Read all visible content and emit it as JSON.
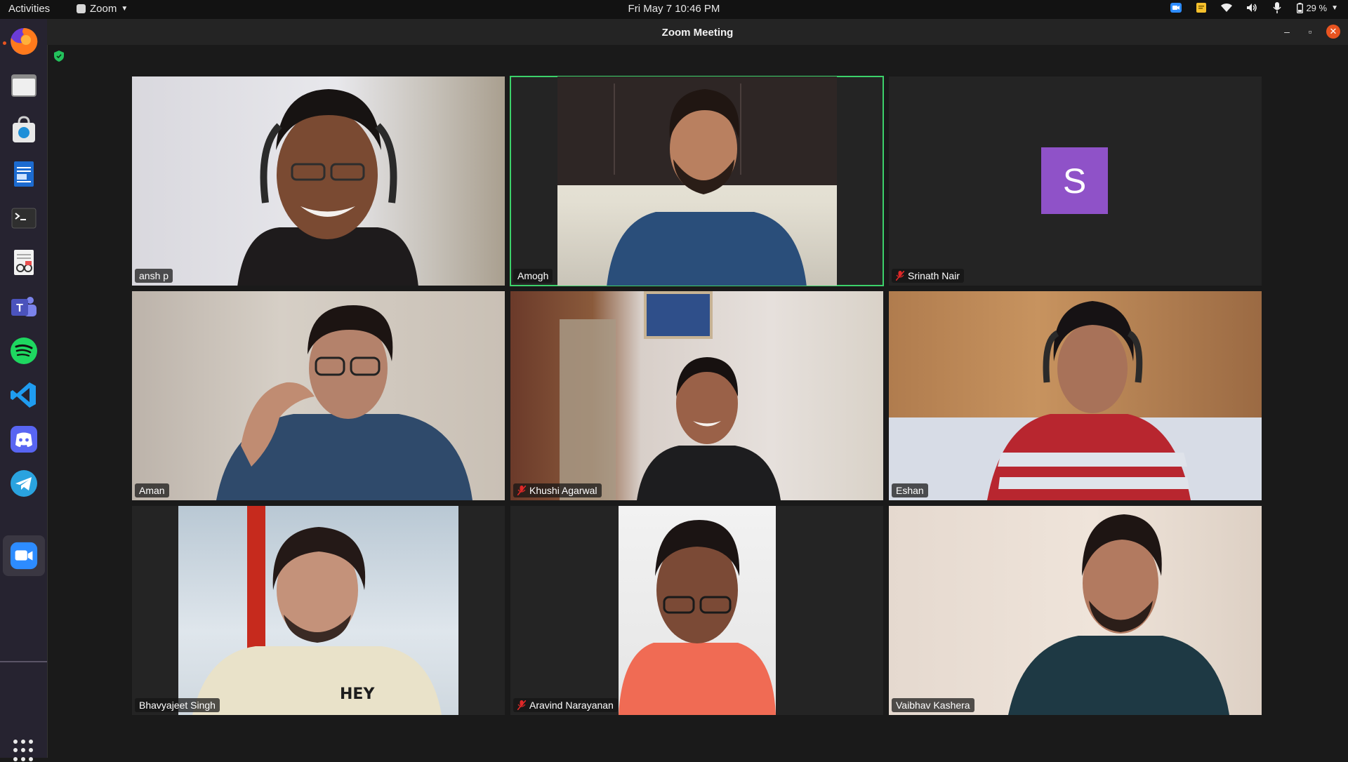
{
  "topbar": {
    "activities": "Activities",
    "app_name": "Zoom",
    "clock": "Fri May 7  10:46 PM",
    "battery": "29 %"
  },
  "window": {
    "title": "Zoom Meeting"
  },
  "participants": [
    {
      "name": "ansh p",
      "muted": false,
      "video": true
    },
    {
      "name": "Amogh",
      "muted": false,
      "video": true,
      "active_speaker": true
    },
    {
      "name": "Srinath Nair",
      "muted": true,
      "video": false,
      "avatar_letter": "S"
    },
    {
      "name": "Aman",
      "muted": false,
      "video": true
    },
    {
      "name": "Khushi Agarwal",
      "muted": true,
      "video": true
    },
    {
      "name": "Eshan",
      "muted": false,
      "video": true
    },
    {
      "name": "Bhavyajeet Singh",
      "muted": false,
      "video": true
    },
    {
      "name": "Aravind Narayanan",
      "muted": true,
      "video": true
    },
    {
      "name": "Vaibhav Kashera",
      "muted": false,
      "video": true
    }
  ],
  "dock": [
    "firefox-icon",
    "files-icon",
    "software-icon",
    "writer-icon",
    "terminal-icon",
    "document-viewer-icon",
    "teams-icon",
    "spotify-icon",
    "vscode-icon",
    "discord-icon",
    "telegram-icon",
    "zoom-icon"
  ],
  "colors": {
    "speaker_border": "#3cd16a",
    "avatar": "#8f52c8",
    "accent": "#e95420"
  }
}
